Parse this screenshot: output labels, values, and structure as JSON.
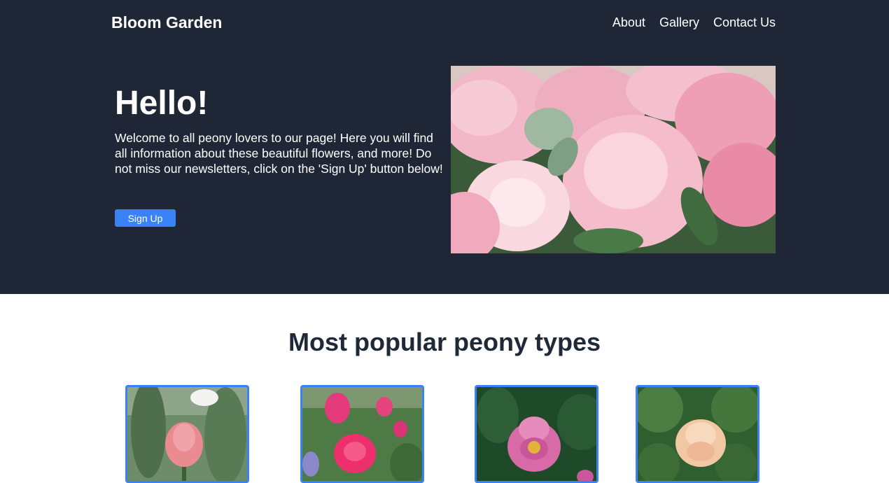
{
  "header": {
    "brand": "Bloom Garden",
    "nav": [
      {
        "label": "About"
      },
      {
        "label": "Gallery"
      },
      {
        "label": "Contact Us"
      }
    ]
  },
  "hero": {
    "title": "Hello!",
    "description": "Welcome to all peony lovers to our page! Here you will find all information about these beautiful flowers, and more! Do not miss our newsletters, click on the 'Sign Up' button below!",
    "button_label": "Sign Up",
    "image": "pink-peony-bouquet-photo"
  },
  "popular": {
    "title": "Most popular peony types",
    "cards": [
      {
        "image": "pink-peony-bud-photo"
      },
      {
        "image": "magenta-peony-bush-photo"
      },
      {
        "image": "pink-open-peony-photo"
      },
      {
        "image": "peach-peony-photo"
      }
    ]
  },
  "colors": {
    "hero_background": "#1f2737",
    "accent": "#3b82f6",
    "heading_text": "#1f2937"
  }
}
